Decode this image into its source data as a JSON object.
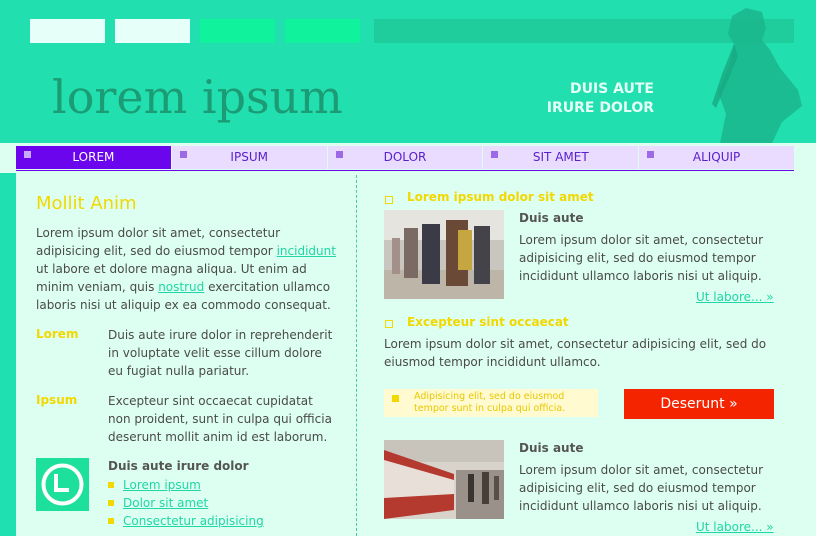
{
  "header": {
    "logo": "lorem ipsum",
    "tagline_line1": "DUIS AUTE",
    "tagline_line2": "IRURE DOLOR",
    "colors": {
      "box1": "#e6fff8",
      "box2": "#e6fff8",
      "box3": "#11f29c",
      "box4": "#11f29c",
      "bar": "#1fcc9c"
    }
  },
  "nav": {
    "items": [
      {
        "label": "LOREM",
        "active": true
      },
      {
        "label": "IPSUM",
        "active": false
      },
      {
        "label": "DOLOR",
        "active": false
      },
      {
        "label": "SIT AMET",
        "active": false
      },
      {
        "label": "ALIQUIP",
        "active": false
      }
    ]
  },
  "left": {
    "title": "Mollit Anim",
    "intro_part1": "Lorem ipsum dolor sit amet, consectetur adipisicing elit, sed do eiusmod tempor",
    "intro_link1": "incididunt",
    "intro_part2": "ut labore et dolore magna aliqua. Ut enim ad minim veniam, quis",
    "intro_link2": "nostrud",
    "intro_part3": "exercitation ullamco laboris nisi ut aliquip ex ea commodo consequat.",
    "item1_label": "Lorem",
    "item1_text": "Duis aute irure dolor in reprehenderit in voluptate velit esse cillum dolore eu fugiat nulla pariatur.",
    "item2_label": "Ipsum",
    "item2_text": "Excepteur sint occaecat cupidatat non proident, sunt in culpa qui officia deserunt mollit anim id est laborum.",
    "list_title": "Duis aute irure dolor",
    "links": [
      "Lorem ipsum",
      "Dolor sit amet",
      "Consectetur adipisicing"
    ]
  },
  "right": {
    "article1_title": "Lorem ipsum dolor sit amet",
    "article1_subhead": "Duis aute",
    "article1_text": "Lorem ipsum dolor sit amet, consectetur adipisicing elit, sed do eiusmod tempor incididunt ullamco laboris nisi ut aliquip.",
    "article1_more": "Ut labore... »",
    "section2_title": "Excepteur sint occaecat",
    "section2_text": "Lorem ipsum dolor sit amet, consectetur adipisicing elit, sed do eiusmod tempor incididunt ullamco.",
    "promo_text_line1": "Adipisicing elit, sed do eiusmod",
    "promo_text_line2": "tempor sunt in culpa qui officia.",
    "button_label": "Deserunt »",
    "article2_subhead": "Duis aute",
    "article2_text": "Lorem ipsum dolor sit amet, consectetur adipisicing elit, sed do eiusmod tempor incididunt ullamco laboris nisi ut aliquip.",
    "article2_more": "Ut labore... »"
  }
}
